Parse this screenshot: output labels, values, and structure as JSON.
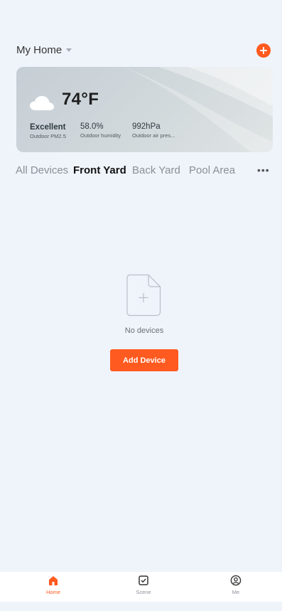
{
  "header": {
    "home_name": "My Home"
  },
  "weather": {
    "temperature": "74°F",
    "pm25_value": "Excellent",
    "pm25_label": "Outdoor PM2.5",
    "humidity_value": "58.0%",
    "humidity_label": "Outdoor humidity",
    "pressure_value": "992hPa",
    "pressure_label": "Outdoor air pres..."
  },
  "tabs": [
    {
      "label": "All Devices",
      "active": false
    },
    {
      "label": "Front Yard",
      "active": true
    },
    {
      "label": "Back Yard",
      "active": false
    },
    {
      "label": "Pool Area",
      "active": false
    }
  ],
  "more_label": "•••",
  "empty_state": {
    "message": "No devices",
    "button_label": "Add Device"
  },
  "bottom_nav": [
    {
      "label": "Home",
      "icon": "home-icon",
      "active": true
    },
    {
      "label": "Scene",
      "icon": "scene-icon",
      "active": false
    },
    {
      "label": "Me",
      "icon": "profile-icon",
      "active": false
    }
  ],
  "colors": {
    "accent": "#ff5a1f",
    "background": "#eff4fb"
  }
}
